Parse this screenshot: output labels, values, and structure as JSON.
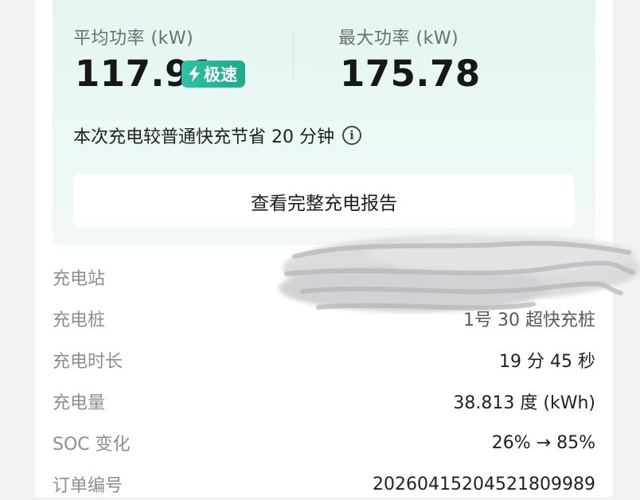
{
  "summary": {
    "avg_power_label": "平均功率 (kW)",
    "avg_power_value": "117.91",
    "badge_label": "极速",
    "max_power_label": "最大功率 (kW)",
    "max_power_value": "175.78",
    "saving_text": "本次充电较普通快充节省 20 分钟",
    "report_button": "查看完整充电报告"
  },
  "details": [
    {
      "label": "充电站",
      "value": ""
    },
    {
      "label": "充电桩",
      "value": "1号 30 超快充桩"
    },
    {
      "label": "充电时长",
      "value": "19 分 45 秒"
    },
    {
      "label": "充电量",
      "value": "38.813 度 (kWh)"
    },
    {
      "label": "SOC 变化",
      "value": "26% → 85%"
    },
    {
      "label": "订单编号",
      "value": "20260415204521809989"
    }
  ],
  "colors": {
    "accent": "#22a98b",
    "summary_bg": "#e8f6f3",
    "label_gray": "#8b8e91"
  },
  "icons": [
    "lightning-icon",
    "info-icon"
  ]
}
